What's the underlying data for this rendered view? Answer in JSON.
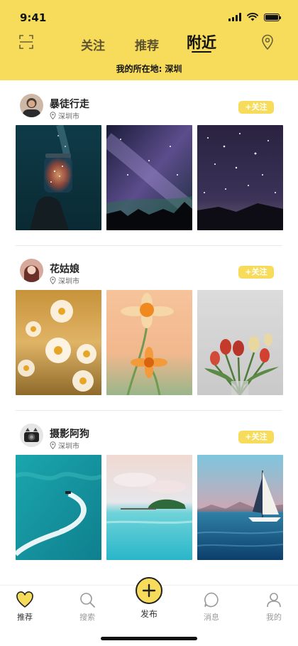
{
  "status_bar": {
    "time": "9:41"
  },
  "header": {
    "tabs": [
      "关注",
      "推荐",
      "附近"
    ],
    "active_tab": "附近",
    "location_label": "我的所在地:",
    "location_value": "深圳",
    "accent_color": "#F6DC5A"
  },
  "icons": {
    "left": "scan-icon",
    "right": "location-pin-icon"
  },
  "posts": [
    {
      "username": "暴徒行走",
      "city": "深圳市",
      "follow_label": "+关注",
      "photos": [
        "starry-jar-hand",
        "milky-way-silhouette",
        "star-field-mountains"
      ]
    },
    {
      "username": "花姑娘",
      "city": "深圳市",
      "follow_label": "+关注",
      "photos": [
        "daisy-field",
        "orange-flowers",
        "red-tulips"
      ]
    },
    {
      "username": "摄影阿狗",
      "city": "深圳市",
      "follow_label": "+关注",
      "photos": [
        "jet-ski-wake",
        "tropical-island",
        "sailboat-sea"
      ]
    }
  ],
  "tab_bar": {
    "items": [
      {
        "label": "推荐",
        "icon": "heart-icon",
        "active": true
      },
      {
        "label": "搜索",
        "icon": "search-icon",
        "active": false
      },
      {
        "label": "发布",
        "icon": "plus-icon",
        "active": false
      },
      {
        "label": "消息",
        "icon": "message-icon",
        "active": false
      },
      {
        "label": "我的",
        "icon": "user-icon",
        "active": false
      }
    ]
  }
}
